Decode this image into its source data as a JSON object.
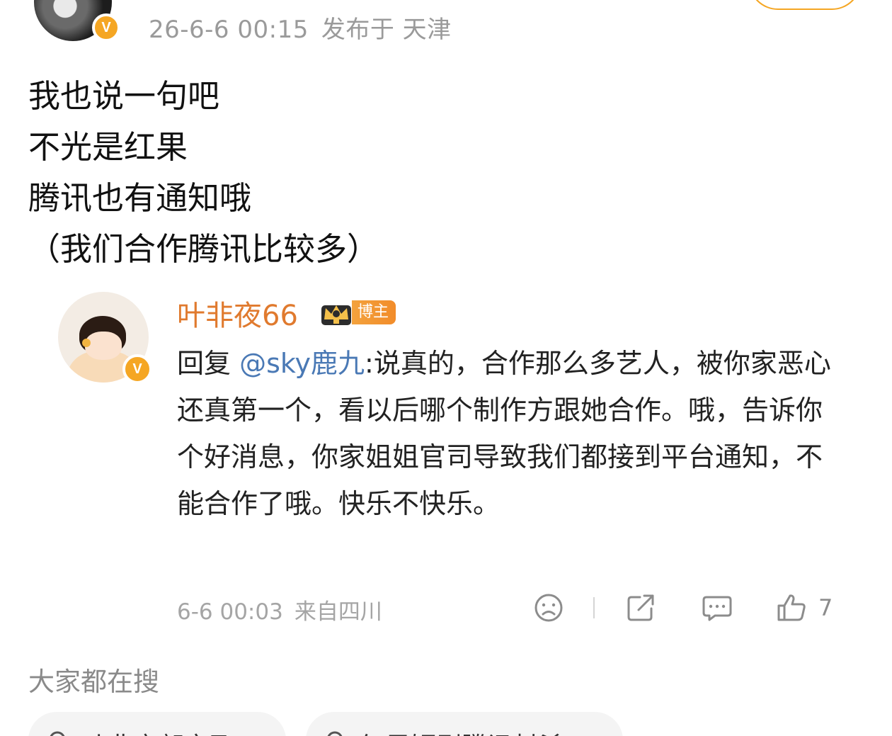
{
  "post": {
    "timestamp": "26-6-6 00:15",
    "location_label": "发布于 天津",
    "body_lines": [
      "我也说一句吧",
      "不光是红果",
      "腾讯也有通知哦",
      "（我们合作腾讯比较多）"
    ]
  },
  "quoted_comment": {
    "username": "叶非夜66",
    "role_badge": "博主",
    "reply_prefix": "回复 ",
    "mention": "@sky鹿九",
    "text": ":说真的，合作那么多艺人，被你家恶心还真第一个，看以后哪个制作方跟她合作。哦，告诉你个好消息，你家姐姐官司导致我们都接到平台通知，不能合作了哦。快乐不快乐。",
    "time": "6-6 00:03",
    "source": "来自四川",
    "like_count": "7"
  },
  "trending": {
    "title": "大家都在搜",
    "items": [
      "叶非夜郭京飞",
      "红果短剧腾讯封杀"
    ]
  },
  "badges": {
    "verified": "V"
  },
  "colors": {
    "accent_orange": "#f5a623",
    "username_orange": "#e07a2e",
    "mention_blue": "#4a79b5",
    "meta_gray": "#9a9a9a"
  },
  "icons": [
    "verified-badge-icon",
    "crown-level-icon",
    "dislike-icon",
    "share-icon",
    "comment-icon",
    "like-icon",
    "search-icon"
  ]
}
